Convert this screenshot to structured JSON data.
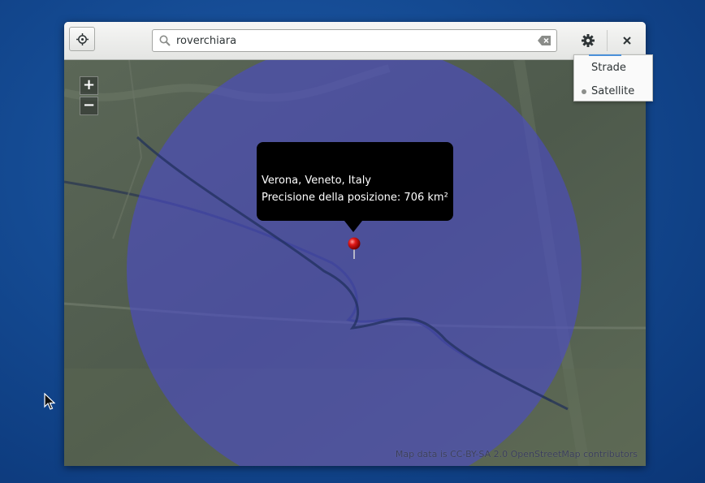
{
  "header": {
    "search_value": "roverchiara",
    "locate_icon": "crosshair-icon",
    "clear_icon": "clear-text-icon",
    "settings_icon": "gear-icon",
    "close_icon": "close-icon"
  },
  "map": {
    "zoom_in_label": "+",
    "zoom_out_label": "−",
    "attribution": "Map data is CC-BY-SA 2.0 OpenStreetMap contributors",
    "accuracy_circle_color": "#4a4ac8"
  },
  "bubble": {
    "place": "Verona, Veneto, Italy",
    "accuracy": "Precisione della posizione: 706 km²"
  },
  "layers_menu": {
    "options": [
      "Strade",
      "Satellite"
    ],
    "selected": "Satellite"
  }
}
